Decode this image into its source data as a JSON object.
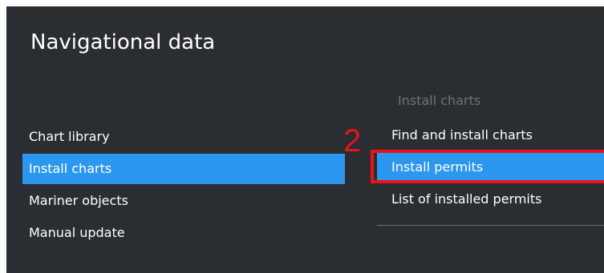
{
  "page": {
    "title": "Navigational data"
  },
  "left_menu": {
    "items": [
      {
        "label": "Chart library",
        "selected": false
      },
      {
        "label": "Install charts",
        "selected": true
      },
      {
        "label": "Mariner objects",
        "selected": false
      },
      {
        "label": "Manual update",
        "selected": false
      }
    ]
  },
  "submenu": {
    "header": "Install charts",
    "items": [
      {
        "label": "Find and install charts",
        "selected": false
      },
      {
        "label": "Install permits",
        "selected": true
      },
      {
        "label": "List of installed permits",
        "selected": false
      }
    ]
  },
  "annotation": {
    "step_number": "2",
    "color": "#e8141b"
  },
  "colors": {
    "background": "#2a2d31",
    "accent": "#2b97ef",
    "muted_text": "#6f7478"
  }
}
